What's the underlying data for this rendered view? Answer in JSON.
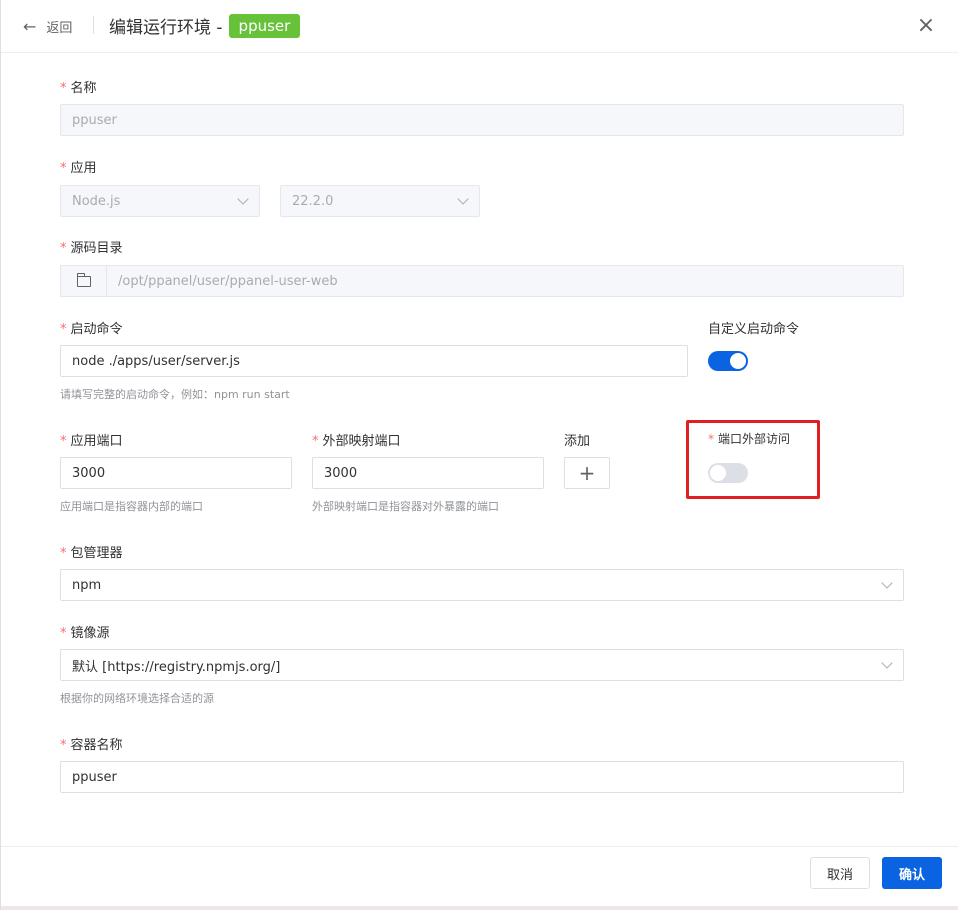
{
  "header": {
    "back_label": "返回",
    "title": "编辑运行环境 -",
    "tag": "ppuser"
  },
  "form": {
    "name": {
      "label": "名称",
      "value": "ppuser"
    },
    "app": {
      "label": "应用",
      "type_value": "Node.js",
      "version_value": "22.2.0"
    },
    "source_dir": {
      "label": "源码目录",
      "value": "/opt/ppanel/user/ppanel-user-web"
    },
    "start_cmd": {
      "label": "启动命令",
      "value": "node ./apps/user/server.js",
      "hint": "请填写完整的启动命令，例如：npm run start"
    },
    "custom_cmd": {
      "label": "自定义启动命令",
      "enabled": true
    },
    "app_port": {
      "label": "应用端口",
      "value": "3000",
      "hint": "应用端口是指容器内部的端口"
    },
    "host_port": {
      "label": "外部映射端口",
      "value": "3000",
      "hint": "外部映射端口是指容器对外暴露的端口"
    },
    "add": {
      "label": "添加",
      "button": "+"
    },
    "port_external": {
      "label": "端口外部访问",
      "enabled": false
    },
    "package_manager": {
      "label": "包管理器",
      "value": "npm"
    },
    "mirror": {
      "label": "镜像源",
      "value": "默认 [https://registry.npmjs.org/]",
      "hint": "根据你的网络环境选择合适的源"
    },
    "container_name": {
      "label": "容器名称",
      "value": "ppuser"
    },
    "required_mark": "*"
  },
  "footer": {
    "cancel": "取消",
    "confirm": "确认"
  },
  "colors": {
    "accent": "#0a63e0",
    "tag": "#67c23a",
    "required": "#f56c6c",
    "highlight": "#e02020"
  },
  "icons": {
    "back": "arrow-left-icon",
    "close": "close-icon",
    "folder": "folder-icon",
    "chevron": "chevron-down-icon",
    "add": "plus-icon"
  }
}
